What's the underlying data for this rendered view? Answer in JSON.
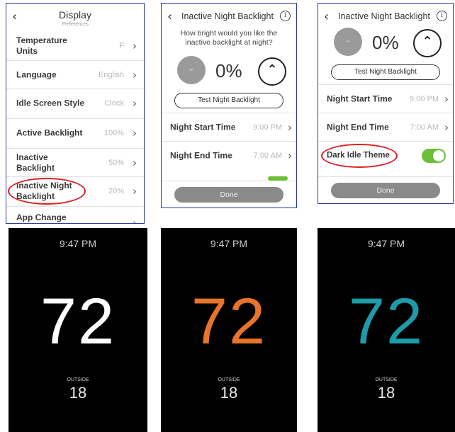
{
  "panel1": {
    "title": "Display",
    "subtitle": "Preferences",
    "back_icon": "chevron-left",
    "items": [
      {
        "label": "Temperature Units",
        "value": "F"
      },
      {
        "label": "Language",
        "value": "English"
      },
      {
        "label": "Idle Screen Style",
        "value": "Clock"
      },
      {
        "label": "Active Backlight",
        "value": "100%"
      },
      {
        "label": "Inactive Backlight",
        "value": "50%"
      },
      {
        "label": "Inactive Night Backlight",
        "value": "20%"
      },
      {
        "label": "App Change",
        "value": ""
      }
    ]
  },
  "panel2": {
    "title": "Inactive Night Backlight",
    "question": "How bright would you like the inactive backlight at night?",
    "percent": "0%",
    "test_button": "Test Night Backlight",
    "rows": [
      {
        "label": "Night Start Time",
        "value": "9:00 PM"
      },
      {
        "label": "Night End Time",
        "value": "7:00 AM"
      }
    ],
    "done": "Done"
  },
  "panel3": {
    "title": "Inactive Night Backlight",
    "percent": "0%",
    "test_button": "Test Night Backlight",
    "rows": [
      {
        "label": "Night Start Time",
        "value": "9:00 PM"
      },
      {
        "label": "Night End Time",
        "value": "7:00 AM"
      }
    ],
    "toggle_label": "Dark Idle Theme",
    "toggle_state": "on",
    "done": "Done"
  },
  "idle_screens": [
    {
      "time": "9:47 PM",
      "temperature": "72",
      "outside_label": "OUTSIDE",
      "outside_value": "18",
      "color": "#ffffff"
    },
    {
      "time": "9:47 PM",
      "temperature": "72",
      "outside_label": "OUTSIDE",
      "outside_value": "18",
      "color": "#e8732a"
    },
    {
      "time": "9:47 PM",
      "temperature": "72",
      "outside_label": "OUTSIDE",
      "outside_value": "18",
      "color": "#1e9aa8"
    }
  ],
  "colors": {
    "accent_green": "#6bbf3a",
    "highlight_red": "#e02020",
    "frame_blue": "#2a3aa8"
  }
}
